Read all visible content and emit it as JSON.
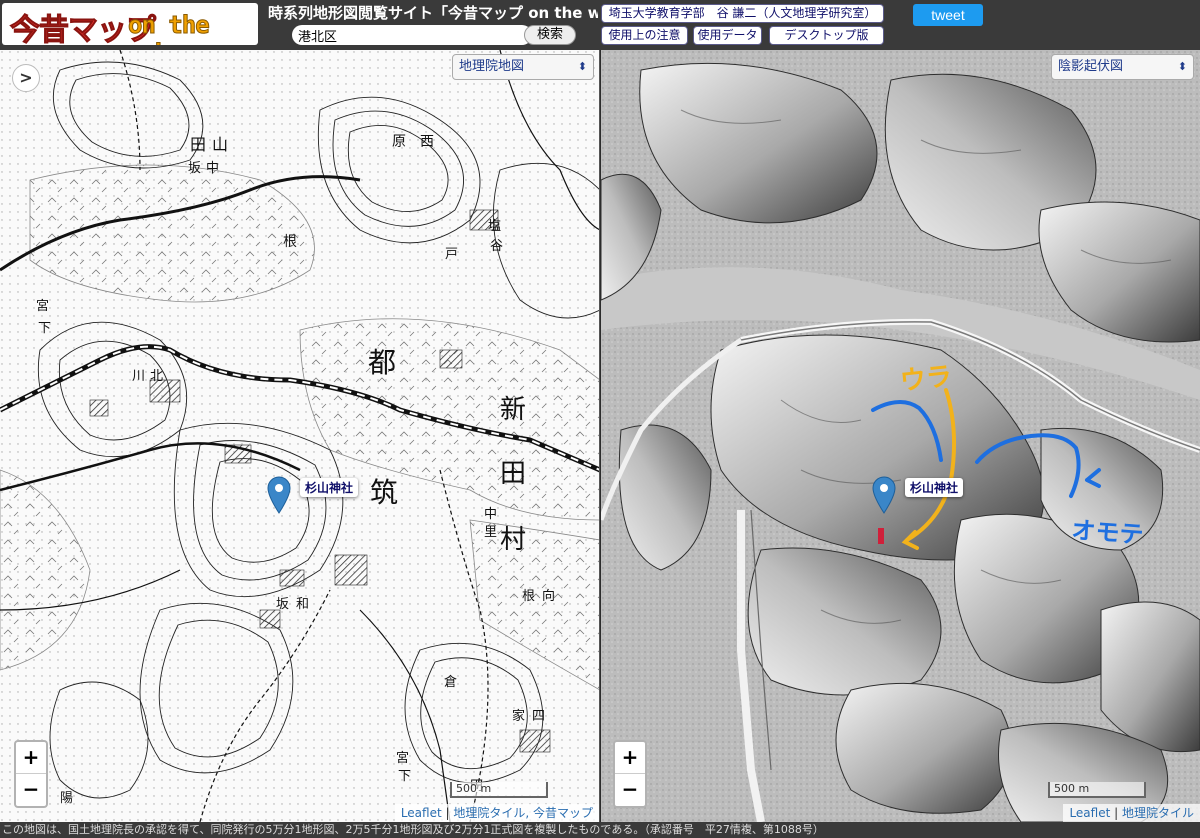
{
  "logo": {
    "main": "今昔マップ",
    "sub": "on the web"
  },
  "header": {
    "title": "時系列地形図閲覧サイト「今昔マップ on the web」",
    "search_value": "港北区",
    "search_button": "検索",
    "author": "埼玉大学教育学部　谷 謙二（人文地理学研究室）",
    "buttons": [
      "使用上の注意",
      "使用データ",
      "デスクトップ版"
    ],
    "tweet": "tweet"
  },
  "left_map": {
    "toggle": ">",
    "layer": "地理院地図",
    "marker_label": "杉山神社",
    "zoom_in": "+",
    "zoom_out": "−",
    "scale": "500 m",
    "attribution_leaflet": "Leaflet",
    "attribution_sep": " | ",
    "attribution_rest": "地理院タイル, 今昔マップ",
    "map_labels": [
      "田",
      "山",
      "坂",
      "中",
      "原",
      "西",
      "根",
      "塩",
      "谷",
      "戸",
      "宮",
      "下",
      "川",
      "北",
      "都",
      "新",
      "田",
      "筑",
      "村",
      "中",
      "里",
      "根",
      "向",
      "坂",
      "和",
      "倉",
      "家",
      "四",
      "宮",
      "下",
      "陽",
      "円"
    ]
  },
  "right_map": {
    "layer": "陰影起伏図",
    "marker_label": "杉山神社",
    "zoom_in": "+",
    "zoom_out": "−",
    "scale": "500 m",
    "attribution_leaflet": "Leaflet",
    "attribution_sep": " | ",
    "attribution_rest": "地理院タイル",
    "annotations": {
      "ura": "ウラ",
      "omote": "オモテ"
    },
    "colors": {
      "blue_annotation": "#1e6fe0",
      "yellow_annotation": "#f2b21b",
      "shrine_mark": "#d0203a"
    }
  },
  "footer": {
    "text": "この地図は、国土地理院長の承認を得て、同院発行の5万分1地形図、2万5千分1地形図及び2万分1正式図を複製したものである。（承認番号　平27情複、第1088号）"
  },
  "colors": {
    "marker": "#3a86c8",
    "header_bg": "#3a3a3a",
    "tweet_bg": "#1d9bf0"
  }
}
